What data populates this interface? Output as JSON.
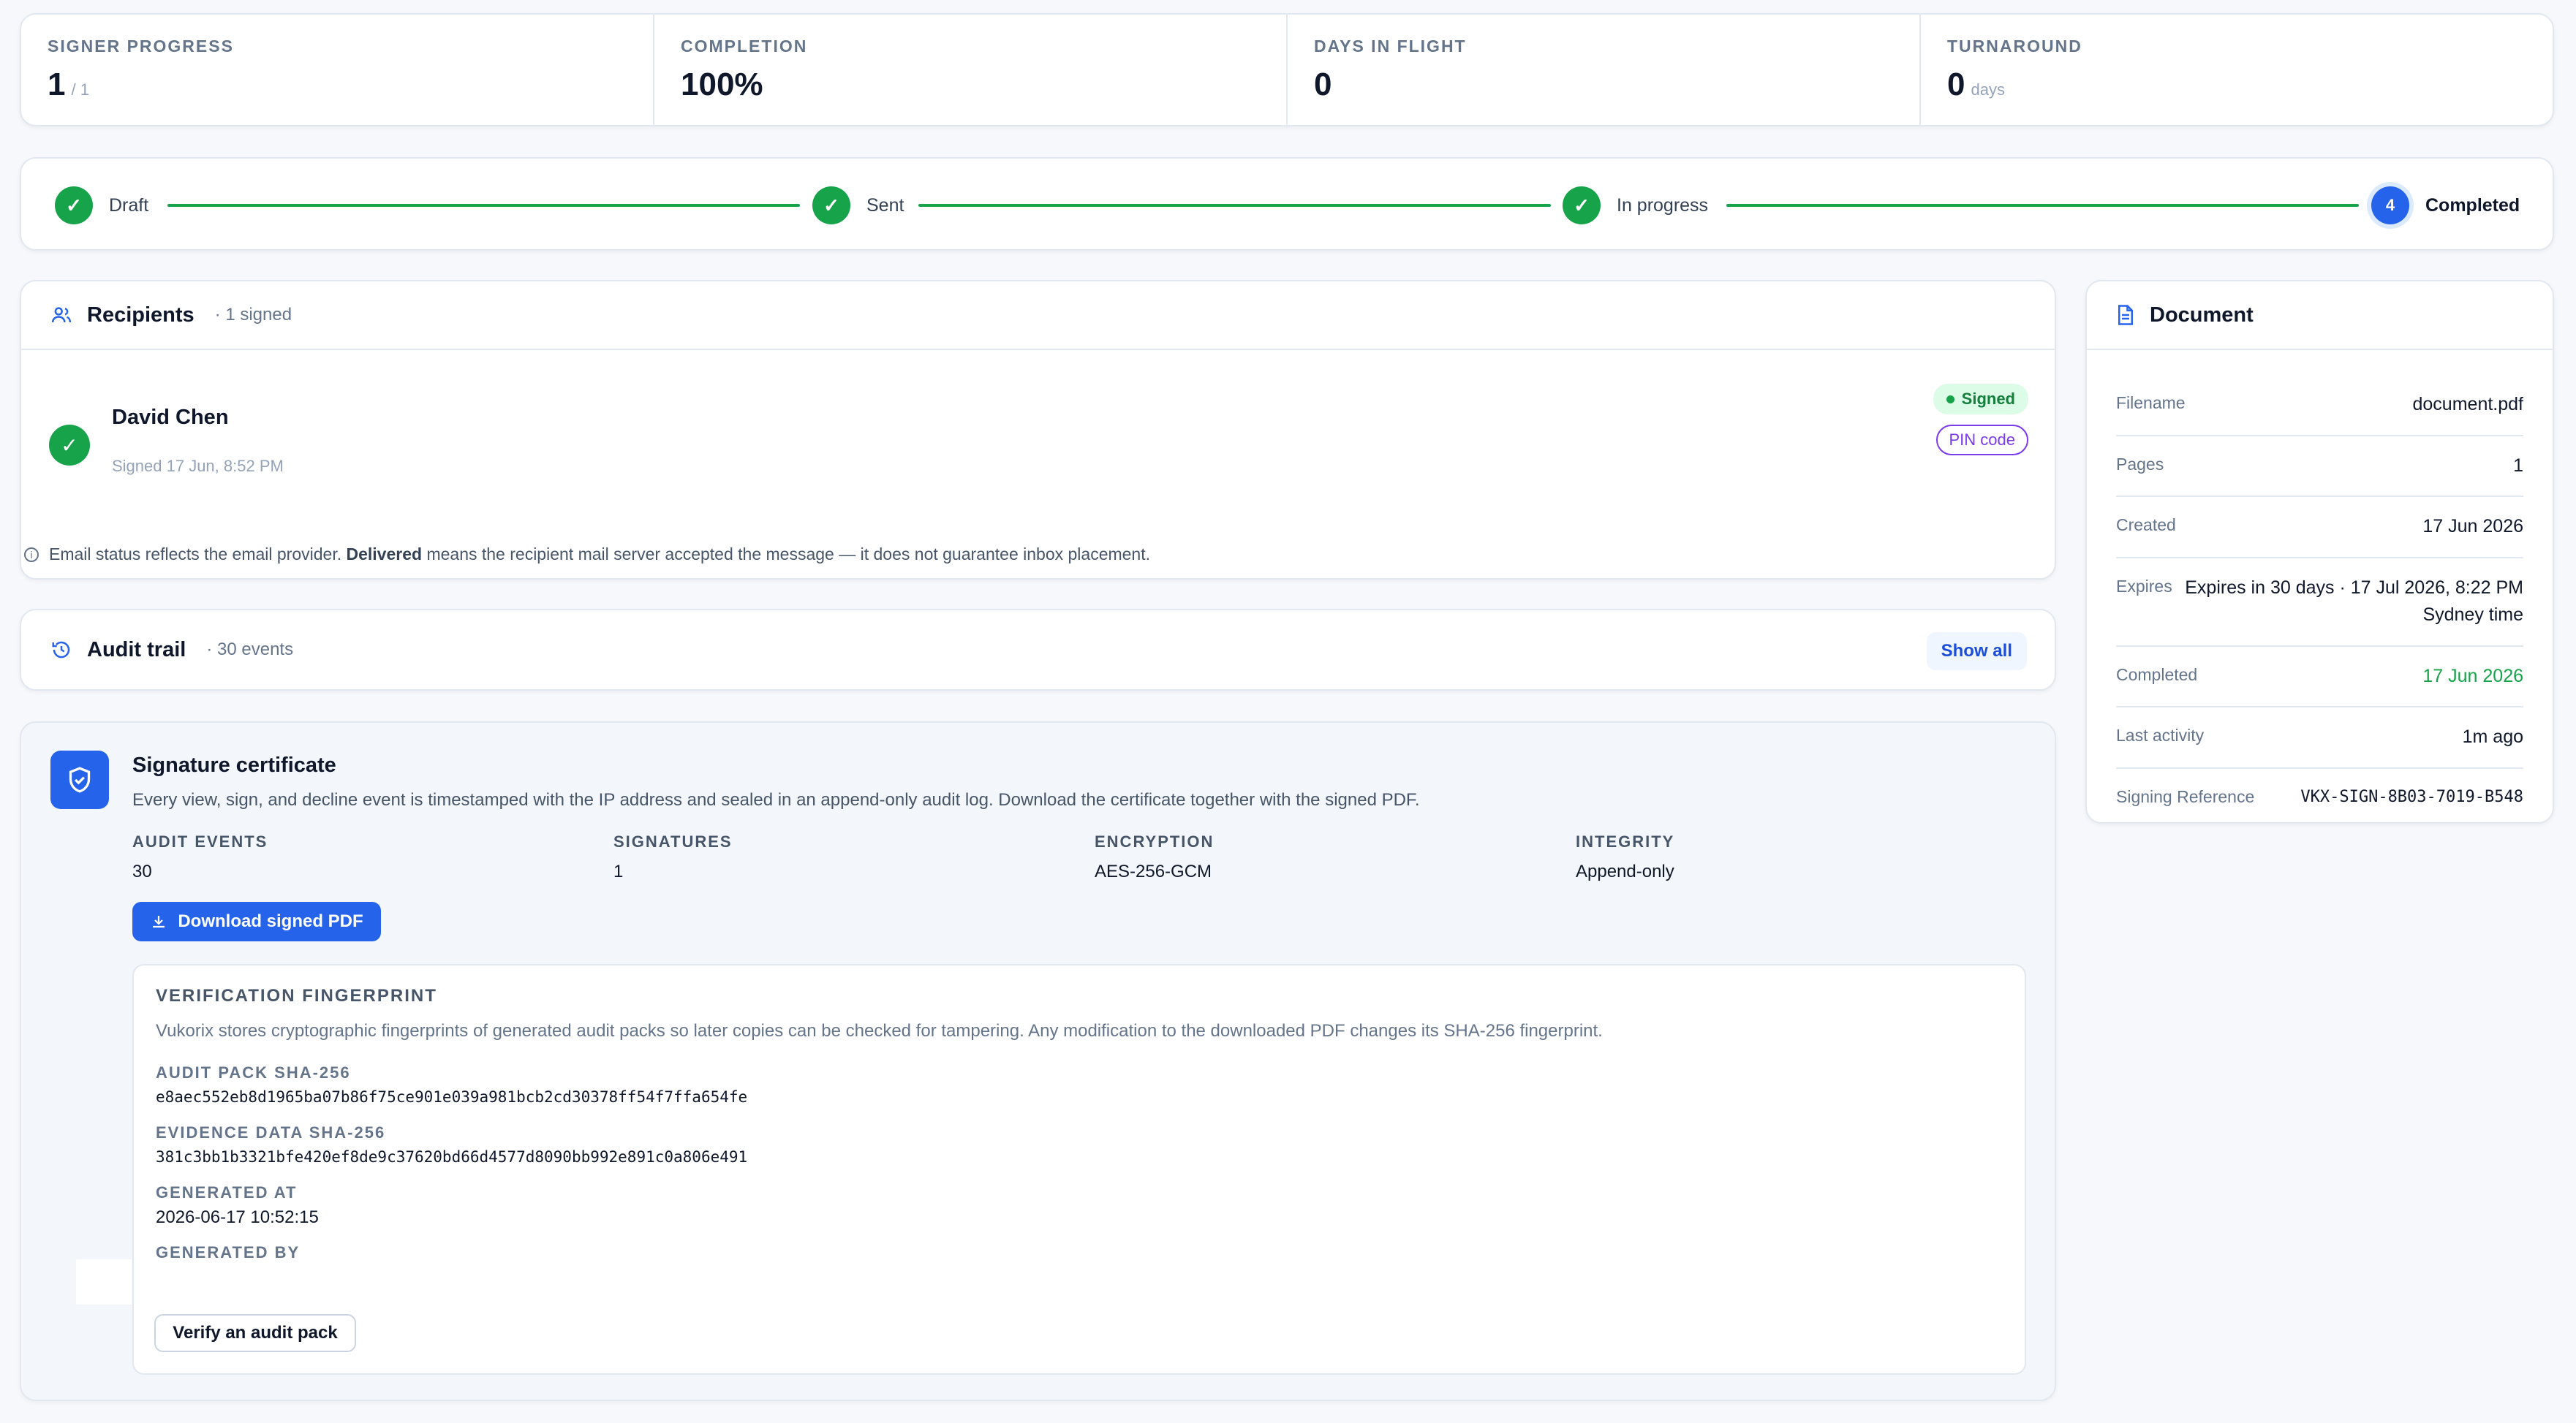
{
  "stats": [
    {
      "label": "SIGNER PROGRESS",
      "value": "1",
      "sub": "/ 1"
    },
    {
      "label": "COMPLETION",
      "value": "100%",
      "sub": ""
    },
    {
      "label": "DAYS IN FLIGHT",
      "value": "0",
      "sub": ""
    },
    {
      "label": "TURNAROUND",
      "value": "0",
      "sub": "days"
    }
  ],
  "steps": [
    {
      "label": "Draft",
      "state": "done"
    },
    {
      "label": "Sent",
      "state": "done"
    },
    {
      "label": "In progress",
      "state": "done"
    },
    {
      "label": "Completed",
      "state": "current",
      "number": "4"
    }
  ],
  "recipients": {
    "title": "Recipients",
    "meta": "· 1 signed",
    "items": [
      {
        "name": "David Chen",
        "status_text": "Signed 17 Jun, 8:52 PM",
        "badge": "Signed",
        "method": "PIN code"
      }
    ],
    "note_prefix": "Email status reflects the email provider.",
    "note_bold": "Delivered",
    "note_suffix": "means the recipient mail server accepted the message — it does not guarantee inbox placement."
  },
  "audit": {
    "title": "Audit trail",
    "meta": "· 30 events",
    "show_all": "Show all"
  },
  "certificate": {
    "title": "Signature certificate",
    "description": "Every view, sign, and decline event is timestamped with the IP address and sealed in an append-only audit log. Download the certificate together with the signed PDF.",
    "metrics": [
      {
        "label": "AUDIT EVENTS",
        "value": "30"
      },
      {
        "label": "SIGNATURES",
        "value": "1"
      },
      {
        "label": "ENCRYPTION",
        "value": "AES-256-GCM"
      },
      {
        "label": "INTEGRITY",
        "value": "Append-only"
      }
    ],
    "download_label": "Download signed PDF",
    "fingerprint": {
      "title": "VERIFICATION FINGERPRINT",
      "description": "Vukorix stores cryptographic fingerprints of generated audit packs so later copies can be checked for tampering. Any modification to the downloaded PDF changes its SHA-256 fingerprint.",
      "audit_pack_label": "AUDIT PACK SHA-256",
      "audit_pack_value": "e8aec552eb8d1965ba07b86f75ce901e039a981bcb2cd30378ff54f7ffa654fe",
      "evidence_label": "EVIDENCE DATA SHA-256",
      "evidence_value": "381c3bb1b3321bfe420ef8de9c37620bd66d4577d8090bb992e891c0a806e491",
      "generated_at_label": "GENERATED AT",
      "generated_at_value": "2026-06-17 10:52:15",
      "generated_by_label": "GENERATED BY",
      "verify_label": "Verify an audit pack"
    }
  },
  "document": {
    "title": "Document",
    "rows": [
      {
        "label": "Filename",
        "value": "document.pdf"
      },
      {
        "label": "Pages",
        "value": "1"
      },
      {
        "label": "Created",
        "value": "17 Jun 2026"
      },
      {
        "label": "Expires",
        "value": "Expires in 30 days · 17 Jul 2026, 8:22 PM Sydney time"
      },
      {
        "label": "Completed",
        "value": "17 Jun 2026"
      },
      {
        "label": "Last activity",
        "value": "1m ago"
      },
      {
        "label": "Signing Reference",
        "value": "VKX-SIGN-8B03-7019-B548"
      }
    ]
  },
  "colors": {
    "accent": "#2563eb",
    "success": "#16a34a",
    "pin": "#7c3aed"
  }
}
